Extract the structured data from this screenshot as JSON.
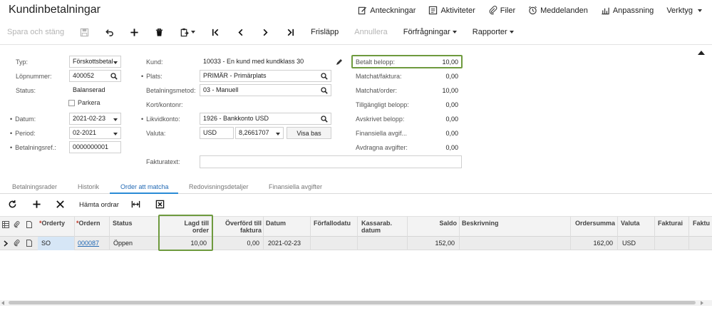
{
  "title": "Kundinbetalningar",
  "top_actions": [
    "Anteckningar",
    "Aktiviteter",
    "Filer",
    "Meddelanden",
    "Anpassning",
    "Verktyg"
  ],
  "toolbar": {
    "save_close": "Spara och stäng",
    "release": "Frisläpp",
    "cancel": "Annullera",
    "inquiries": "Förfrågningar",
    "reports": "Rapporter"
  },
  "form": {
    "typ_label": "Typ:",
    "typ_value": "Förskottsbetal",
    "lopnummer_label": "Löpnummer:",
    "lopnummer_value": "400052",
    "status_label": "Status:",
    "status_value": "Balanserad",
    "parkera_label": "Parkera",
    "datum_label": "Datum:",
    "datum_value": "2021-02-23",
    "period_label": "Period:",
    "period_value": "02-2021",
    "betref_label": "Betalningsref.:",
    "betref_value": "0000000001",
    "kund_label": "Kund:",
    "kund_value": "10033 - En kund med kundklass  30",
    "plats_label": "Plats:",
    "plats_value": "PRIMÄR - Primärplats",
    "betmetod_label": "Betalningsmetod:",
    "betmetod_value": "03 - Manuell",
    "kort_label": "Kort/kontonr:",
    "likvid_label": "Likvidkonto:",
    "likvid_value": "1926 - Bankkonto USD",
    "valuta_label": "Valuta:",
    "valuta_value": "USD",
    "kurs_value": "8,2661707",
    "visa_bas": "Visa bas",
    "fakturatext_label": "Fakturatext:",
    "betalt_label": "Betalt belopp:",
    "betalt_value": "10,00",
    "summary": [
      {
        "label": "Matchat/faktura:",
        "value": "0,00"
      },
      {
        "label": "Matchat/order:",
        "value": "10,00"
      },
      {
        "label": "Tillgängligt belopp:",
        "value": "0,00"
      },
      {
        "label": "Avskrivet belopp:",
        "value": "0,00"
      },
      {
        "label": "Finansiella avgif...",
        "value": "0,00"
      },
      {
        "label": "Avdragna avgifter:",
        "value": "0,00"
      }
    ]
  },
  "tabs": [
    "Betalningsrader",
    "Historik",
    "Order att matcha",
    "Redovisningsdetaljer",
    "Finansiella avgifter"
  ],
  "active_tab": "Order att matcha",
  "grid_toolbar": {
    "fetch_orders": "Hämta ordrar"
  },
  "grid": {
    "headers": {
      "ordertyp": "Ordertу",
      "ordern": "Ordern",
      "status": "Status",
      "lagd_till_order_1": "Lagd till",
      "lagd_till_order_2": "order",
      "overford_1": "Överförd till",
      "overford_2": "faktura",
      "datum": "Datum",
      "forfallodatum": "Förfallodatu",
      "kassarab_1": "Kassarab.",
      "kassarab_2": "datum",
      "saldo": "Saldo",
      "beskrivning": "Beskrivning",
      "ordersumma": "Ordersumma",
      "valuta": "Valuta",
      "faktura1": "Fakturai",
      "faktura2": "Faktu"
    },
    "rows": [
      {
        "ordertyp": "SO",
        "ordern": "000087",
        "status": "Öppen",
        "lagd_till_order": "10,00",
        "overford": "0,00",
        "datum": "2021-02-23",
        "saldo": "152,00",
        "ordersumma": "162,00",
        "valuta": "USD"
      }
    ]
  },
  "colors": {
    "accent": "#2269b4",
    "highlight": "#6e9a3e",
    "tab_underline": "#2a8bd6"
  }
}
